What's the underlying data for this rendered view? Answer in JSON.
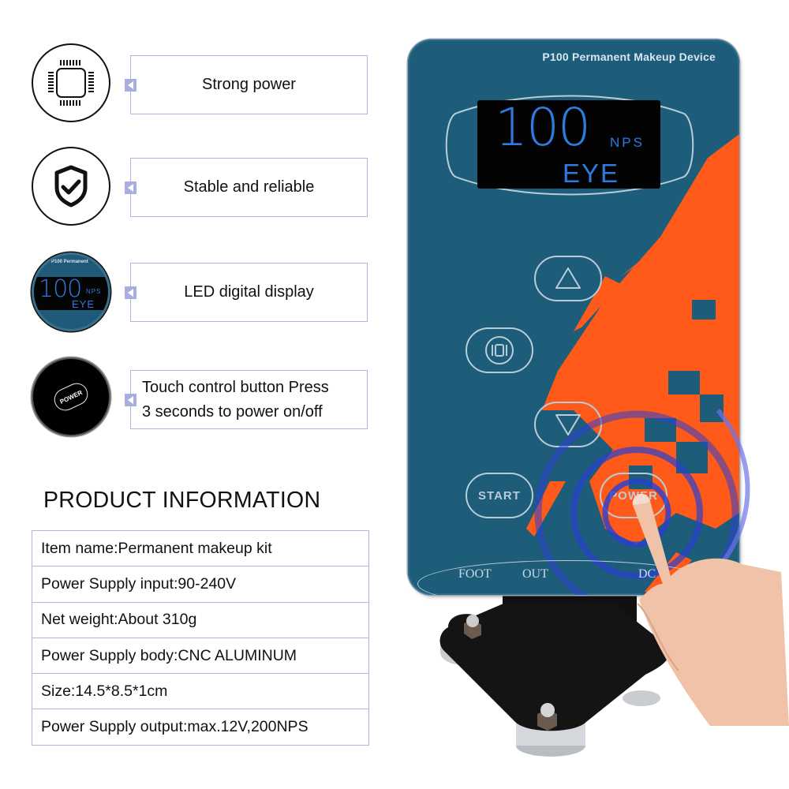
{
  "features": [
    {
      "icon": "chip-icon",
      "label": "Strong power"
    },
    {
      "icon": "shield-check-icon",
      "label": "Stable and reliable"
    },
    {
      "icon": "lcd-display-icon",
      "label": "LED digital display",
      "icon_text": {
        "brand": "P100 Permanent",
        "value": "100",
        "unit": "NPS",
        "mode": "EYE"
      }
    },
    {
      "icon": "power-button-icon",
      "label": "Touch control button Press 3 seconds to power on/off",
      "lines": [
        "Touch control button Press",
        "3 seconds to power on/off"
      ],
      "icon_text": "POWER"
    }
  ],
  "product_info": {
    "title": "PRODUCT INFORMATION",
    "rows": [
      "Item name:Permanent makeup kit",
      "Power Supply input:90-240V",
      "Net weight:About 310g",
      "Power Supply body:CNC ALUMINUM",
      "Size:14.5*8.5*1cm",
      "Power Supply output:max.12V,200NPS"
    ]
  },
  "device": {
    "brand": "P100  Permanent Makeup Device",
    "display": {
      "value": "100",
      "unit": "NPS",
      "mode": "EYE"
    },
    "buttons": {
      "up": "up-arrow",
      "mode": "mode",
      "down": "down-arrow",
      "start": "START",
      "power": "POWER"
    },
    "ports": [
      "FOOT",
      "OUT",
      "DC"
    ],
    "colors": {
      "panel": "#1d5d7a",
      "accent": "#ff5a1a",
      "lcd_text": "#2f7ae0",
      "ring": "#2b3fd0"
    }
  }
}
